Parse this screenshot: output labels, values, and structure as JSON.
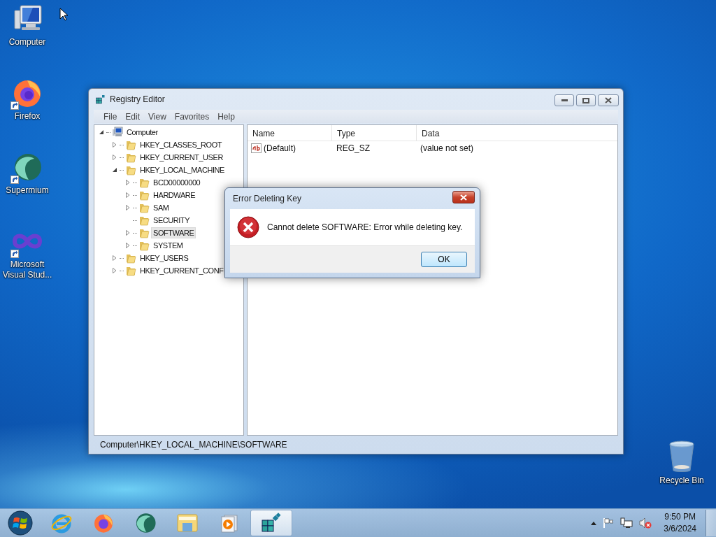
{
  "desktop_icons": [
    {
      "kind": "computer",
      "label": "Computer",
      "shortcut": false
    },
    {
      "kind": "firefox",
      "label": "Firefox",
      "shortcut": true
    },
    {
      "kind": "supermium",
      "label": "Supermium",
      "shortcut": true
    },
    {
      "kind": "visualstudio",
      "label": "Microsoft Visual Stud...",
      "shortcut": true
    }
  ],
  "recycle_bin": {
    "label": "Recycle Bin"
  },
  "window": {
    "title": "Registry Editor",
    "menu": [
      "File",
      "Edit",
      "View",
      "Favorites",
      "Help"
    ],
    "tree": [
      {
        "kind": "computer",
        "label": "Computer",
        "expandable": true,
        "expanded": true,
        "selected": false,
        "children": [
          {
            "kind": "folder",
            "label": "HKEY_CLASSES_ROOT",
            "expandable": true,
            "expanded": false,
            "selected": false
          },
          {
            "kind": "folder",
            "label": "HKEY_CURRENT_USER",
            "expandable": true,
            "expanded": false,
            "selected": false
          },
          {
            "kind": "folder",
            "label": "HKEY_LOCAL_MACHINE",
            "expandable": true,
            "expanded": true,
            "selected": false,
            "children": [
              {
                "kind": "folder",
                "label": "BCD00000000",
                "expandable": true,
                "expanded": false,
                "selected": false
              },
              {
                "kind": "folder",
                "label": "HARDWARE",
                "expandable": true,
                "expanded": false,
                "selected": false
              },
              {
                "kind": "folder",
                "label": "SAM",
                "expandable": true,
                "expanded": false,
                "selected": false
              },
              {
                "kind": "folder",
                "label": "SECURITY",
                "expandable": false,
                "selected": false
              },
              {
                "kind": "folder",
                "label": "SOFTWARE",
                "expandable": true,
                "expanded": false,
                "selected": true
              },
              {
                "kind": "folder",
                "label": "SYSTEM",
                "expandable": true,
                "expanded": false,
                "selected": false
              }
            ]
          },
          {
            "kind": "folder",
            "label": "HKEY_USERS",
            "expandable": true,
            "expanded": false,
            "selected": false
          },
          {
            "kind": "folder",
            "label": "HKEY_CURRENT_CONF",
            "expandable": true,
            "expanded": false,
            "selected": false
          }
        ]
      }
    ],
    "columns": [
      "Name",
      "Type",
      "Data"
    ],
    "values": [
      {
        "kind": "string",
        "name": "(Default)",
        "type": "REG_SZ",
        "data": "(value not set)"
      }
    ],
    "status_bar": "Computer\\HKEY_LOCAL_MACHINE\\SOFTWARE"
  },
  "dialog": {
    "title": "Error Deleting Key",
    "message": "Cannot delete SOFTWARE:  Error while deleting key.",
    "button": "OK"
  },
  "taskbar": {
    "items": [
      {
        "kind": "ie",
        "selected": false
      },
      {
        "kind": "firefox",
        "selected": false
      },
      {
        "kind": "supermium",
        "selected": false
      },
      {
        "kind": "explorer",
        "selected": false
      },
      {
        "kind": "mediaplayer",
        "selected": false
      },
      {
        "kind": "regedit",
        "selected": true
      }
    ],
    "clock": {
      "time": "9:50 PM",
      "date": "3/6/2024"
    }
  }
}
